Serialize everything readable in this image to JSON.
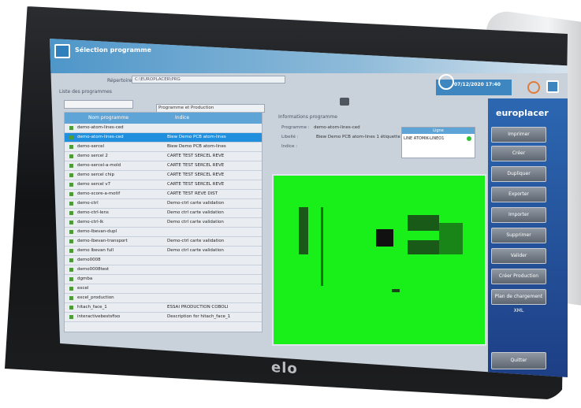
{
  "app": {
    "title": "Sélection programme",
    "path_label": "Répertoire :",
    "path_value": "C:\\EUROPLACER\\PRG",
    "datetime": "07/12/2020 17:40",
    "list_label": "Liste des programmes",
    "filter_value": "Programme et Production"
  },
  "table": {
    "columns": [
      "Nom programme",
      "Indice"
    ],
    "rows": [
      {
        "name": "demo-atom-lines-ced",
        "desc": ""
      },
      {
        "name": "demo-atom-lines-ced",
        "desc": "Biew Demo PCB atom-lines"
      },
      {
        "name": "demo-sercel",
        "desc": "Biew Demo PCB atom-lines"
      },
      {
        "name": "demo sercel 2",
        "desc": "CARTE TEST SERCEL REVE"
      },
      {
        "name": "demo-sercel-a-mold",
        "desc": "CARTE TEST SERCEL REVE"
      },
      {
        "name": "demo sercel chip",
        "desc": "CARTE TEST SERCEL REVE"
      },
      {
        "name": "demo sercel v7",
        "desc": "CARTE TEST SERCEL REVE"
      },
      {
        "name": "demo-score-a-motif",
        "desc": "CARTE TEST REVE DIST"
      },
      {
        "name": "demo-ctrl",
        "desc": "Demo-ctrl carte validation"
      },
      {
        "name": "demo-ctrl-lens",
        "desc": "Demo ctrl carte validation"
      },
      {
        "name": "demo-ctrl-lk",
        "desc": "Demo ctrl carte validation"
      },
      {
        "name": "demo-lbevan-dupl",
        "desc": ""
      },
      {
        "name": "demo-lbevan-transport",
        "desc": "Demo-ctrl carte validation"
      },
      {
        "name": "demo lbevan full",
        "desc": "Demo ctrl carte validation"
      },
      {
        "name": "demo0008",
        "desc": ""
      },
      {
        "name": "demo0008test",
        "desc": ""
      },
      {
        "name": "dgmba",
        "desc": ""
      },
      {
        "name": "excel",
        "desc": ""
      },
      {
        "name": "excel_production",
        "desc": ""
      },
      {
        "name": "hitach_face_1",
        "desc": "ESSAI PRODUCTION COBOLI"
      },
      {
        "name": "interactivebestsfixo",
        "desc": "Description for hitach_face_1"
      }
    ]
  },
  "info": {
    "title": "Informations programme",
    "program_label": "Programme :",
    "program_value": "demo-atom-lines-ced",
    "libelle_label": "Libellé :",
    "libelle_value": "Biew Demo PCB atom-lines 1 étiquette",
    "indice_label": "Indice :",
    "lines_header": "Ligne",
    "line_item": "LINE ATOMIK-LINEO1"
  },
  "sidebar": {
    "brand": "europlacer",
    "buttons": [
      "Imprimer",
      "Créer",
      "Dupliquer",
      "Exporter",
      "Importer",
      "Supprimer",
      "Valider",
      "Créer Production",
      "Plan de chargement XML"
    ],
    "quit": "Quitter"
  },
  "device": {
    "logo": "elo"
  },
  "colors": {
    "accent": "#1f8fde",
    "board": "#19f019",
    "sidebar": "#2c67b1"
  }
}
